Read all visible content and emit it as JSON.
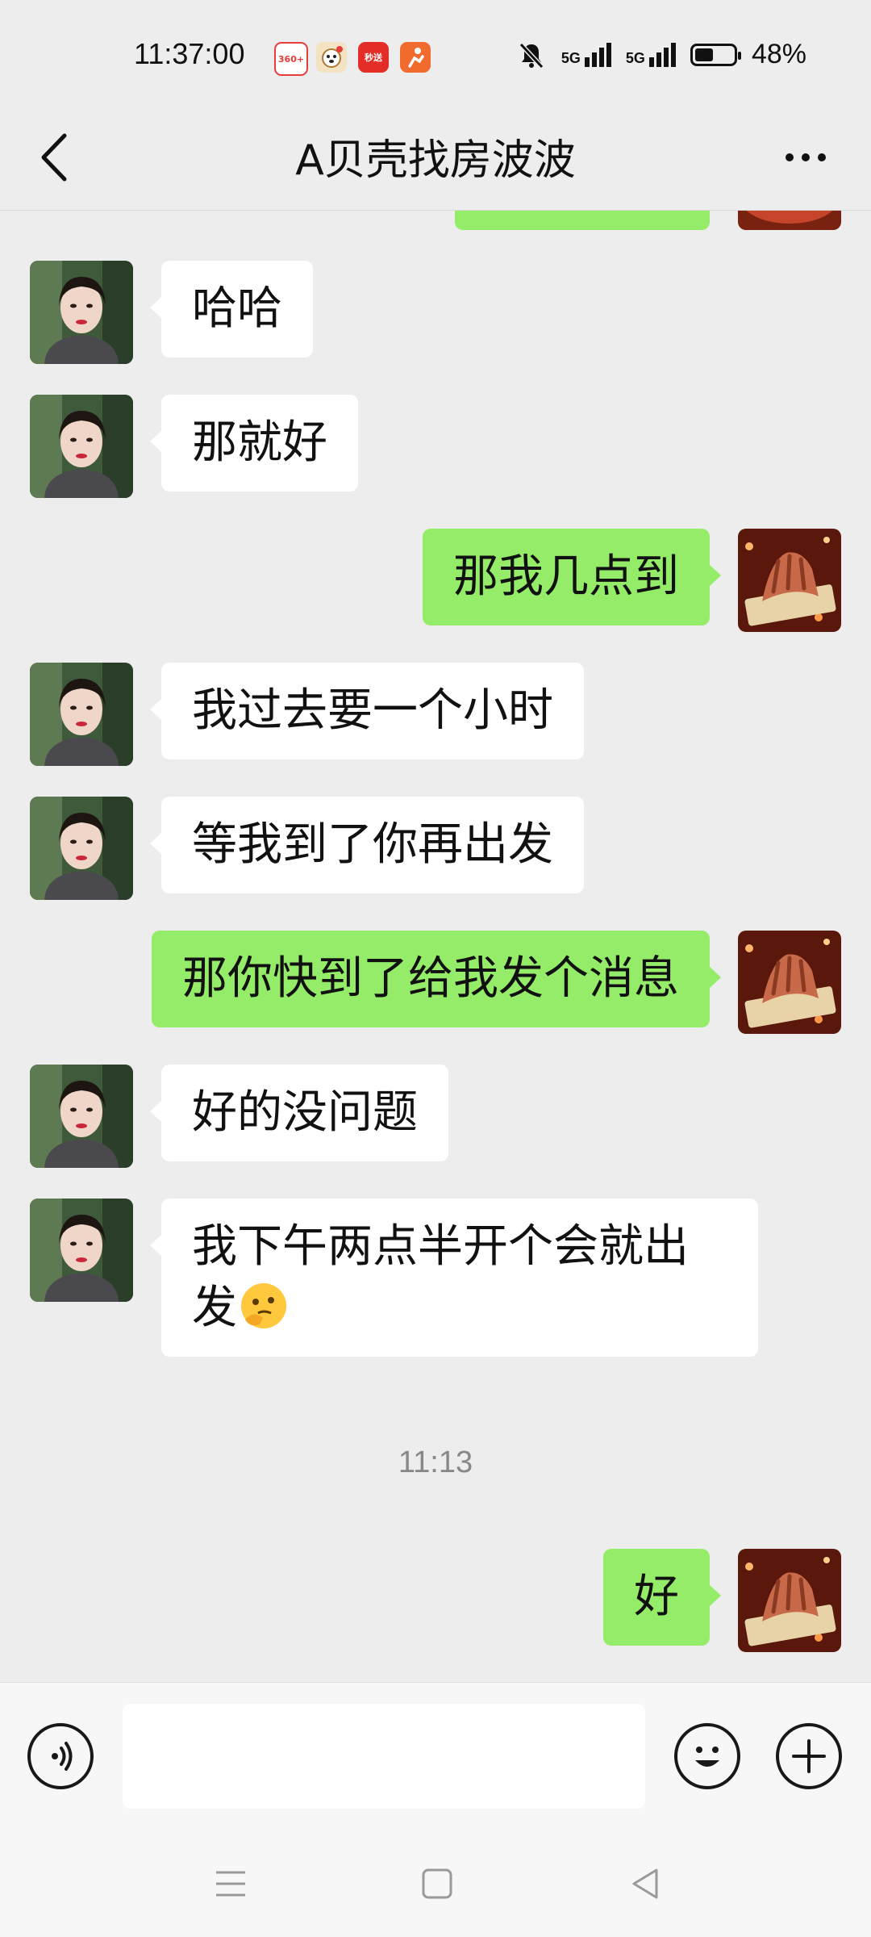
{
  "status": {
    "time": "11:37:00",
    "battery": "48%",
    "battery_level": 0.48,
    "network1": "5G",
    "network2": "5G",
    "app_icons": [
      {
        "name": "360-icon",
        "color": "#e83d3d",
        "text": "360+"
      },
      {
        "name": "dog-app-icon",
        "color": "#d9a35a",
        "text": ""
      },
      {
        "name": "chaosong-icon",
        "color": "#e52d27",
        "text": "秒送"
      },
      {
        "name": "runner-app-icon",
        "color": "#f26b2e",
        "text": ""
      }
    ]
  },
  "header": {
    "title": "A贝壳找房波波"
  },
  "messages": [
    {
      "side": "in",
      "text": "哈哈"
    },
    {
      "side": "in",
      "text": "那就好"
    },
    {
      "side": "out",
      "text": "那我几点到"
    },
    {
      "side": "in",
      "text": "我过去要一个小时"
    },
    {
      "side": "in",
      "text": "等我到了你再出发"
    },
    {
      "side": "out",
      "text": "那你快到了给我发个消息"
    },
    {
      "side": "in",
      "text": "好的没问题"
    },
    {
      "side": "in",
      "text": "我下午两点半开个会就出发"
    },
    {
      "side": "time",
      "text": "11:13"
    },
    {
      "side": "out",
      "text": "好"
    }
  ],
  "colors": {
    "background": "#ededed",
    "incoming_bubble": "#ffffff",
    "outgoing_bubble": "#95ec69",
    "timestamp": "#888888"
  },
  "input": {
    "value": ""
  }
}
